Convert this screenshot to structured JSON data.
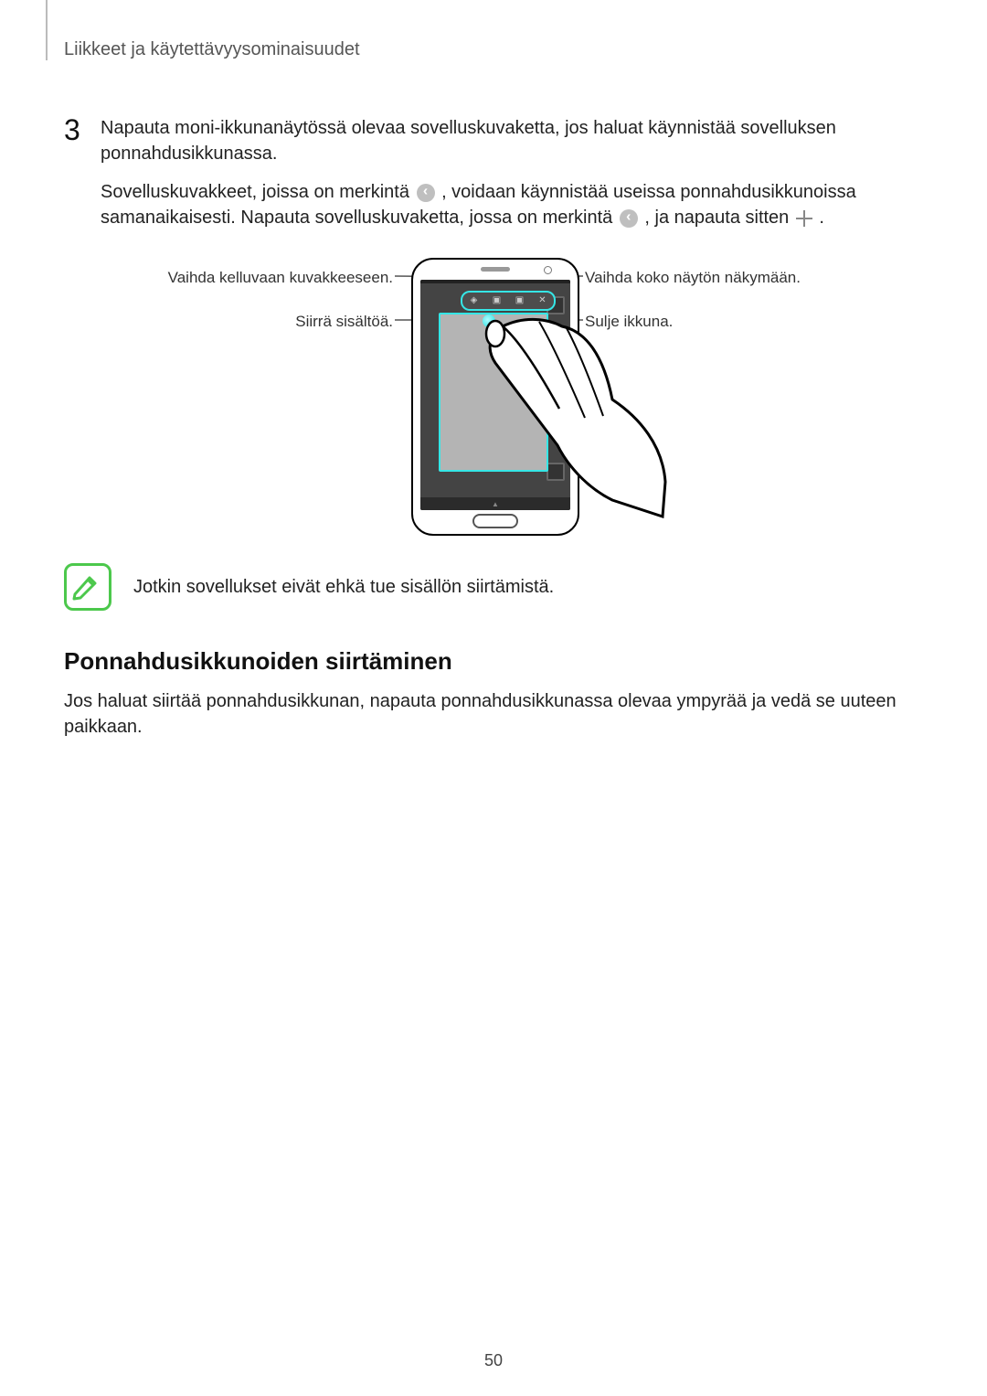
{
  "chapter_title": "Liikkeet ja käytettävyysominaisuudet",
  "step": {
    "number": "3",
    "para1": "Napauta moni-ikkunanäytössä olevaa sovelluskuvaketta, jos haluat käynnistää sovelluksen ponnahdusikkunassa.",
    "para2a": "Sovelluskuvakkeet, joissa on merkintä ",
    "para2b": ", voidaan käynnistää useissa ponnahdusikkunoissa samanaikaisesti. Napauta sovelluskuvaketta, jossa on merkintä ",
    "para2c": ", ja napauta sitten ",
    "para2d": "."
  },
  "callouts": {
    "top_left": "Vaihda kelluvaan kuvakkeeseen.",
    "mid_left": "Siirrä sisältöä.",
    "top_right": "Vaihda koko näytön näkymään.",
    "mid_right": "Sulje ikkuna."
  },
  "note_text": "Jotkin sovellukset eivät ehkä tue sisällön siirtämistä.",
  "subheading": "Ponnahdusikkunoiden siirtäminen",
  "subbody": "Jos haluat siirtää ponnahdusikkunan, napauta ponnahdusikkunassa olevaa ympyrää ja vedä se uuteen paikkaan.",
  "page_number": "50"
}
